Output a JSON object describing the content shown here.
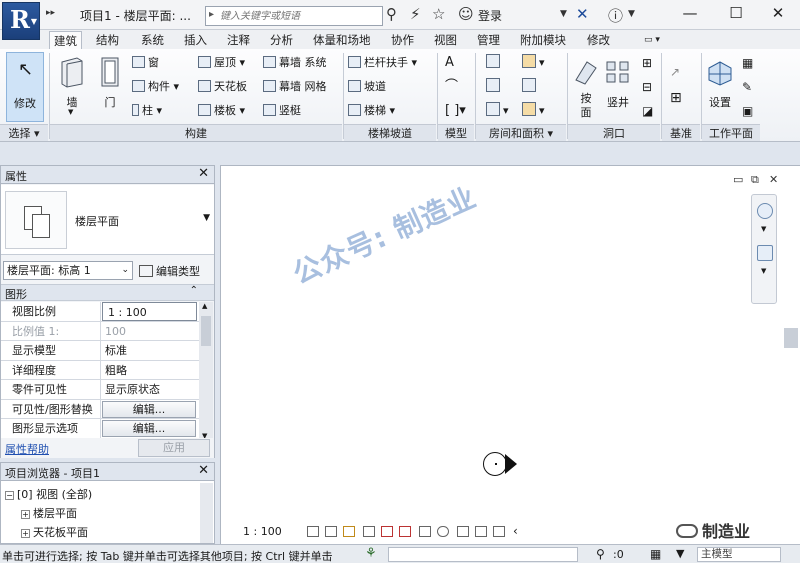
{
  "titlebar": {
    "title": "项目1 - 楼层平面: ...",
    "search_placeholder": "键入关键字或短语",
    "login_label": "登录",
    "app_letter": "R"
  },
  "tabs": [
    {
      "label": "建筑",
      "active": true
    },
    {
      "label": "结构"
    },
    {
      "label": "系统"
    },
    {
      "label": "插入"
    },
    {
      "label": "注释"
    },
    {
      "label": "分析"
    },
    {
      "label": "体量和场地"
    },
    {
      "label": "协作"
    },
    {
      "label": "视图"
    },
    {
      "label": "管理"
    },
    {
      "label": "附加模块"
    },
    {
      "label": "修改"
    }
  ],
  "ribbon": {
    "modify": "修改",
    "wall": "墙",
    "door": "门",
    "window": "窗",
    "component": "构件",
    "column": "柱",
    "roof": "屋顶",
    "ceiling": "天花板",
    "floor": "楼板",
    "curtain_system": "幕墙 系统",
    "curtain_grid": "幕墙 网格",
    "mullion": "竖梃",
    "railing": "栏杆扶手",
    "ramp": "坡道",
    "stair": "楼梯",
    "by_face": "按面",
    "by_face_line1": "按",
    "by_face_line2": "面",
    "shaft": "竖井",
    "set": "设置",
    "panels": {
      "select": "选择",
      "build": "构建",
      "circulation": "楼梯坡道",
      "model": "模型",
      "room_area": "房间和面积",
      "opening": "洞口",
      "datum": "基准",
      "workplane": "工作平面"
    }
  },
  "properties": {
    "header": "属性",
    "type_name": "楼层平面",
    "instance_selector": "楼层平面: 标高 1",
    "edit_type": "编辑类型",
    "category": "图形",
    "rows": [
      {
        "key": "视图比例",
        "value": "1 : 100"
      },
      {
        "key": "比例值 1:",
        "value": "100"
      },
      {
        "key": "显示模型",
        "value": "标准"
      },
      {
        "key": "详细程度",
        "value": "粗略"
      },
      {
        "key": "零件可见性",
        "value": "显示原状态"
      },
      {
        "key": "可见性/图形替换",
        "value": "编辑..."
      },
      {
        "key": "图形显示选项",
        "value": "编辑..."
      }
    ],
    "help": "属性帮助",
    "apply": "应用"
  },
  "browser": {
    "header": "项目浏览器 - 项目1",
    "nodes": [
      {
        "label": "[0] 视图 (全部)"
      },
      {
        "label": "楼层平面"
      },
      {
        "label": "天花板平面"
      }
    ]
  },
  "canvas": {
    "scale": "1 : 100",
    "watermark": "公众号: 制造业",
    "watermark2": "制造业"
  },
  "status": {
    "message": "单击可进行选择; 按 Tab 键并单击可选择其他项目; 按 Ctrl 键并单击",
    "zero": ":0",
    "model": "主模型"
  }
}
